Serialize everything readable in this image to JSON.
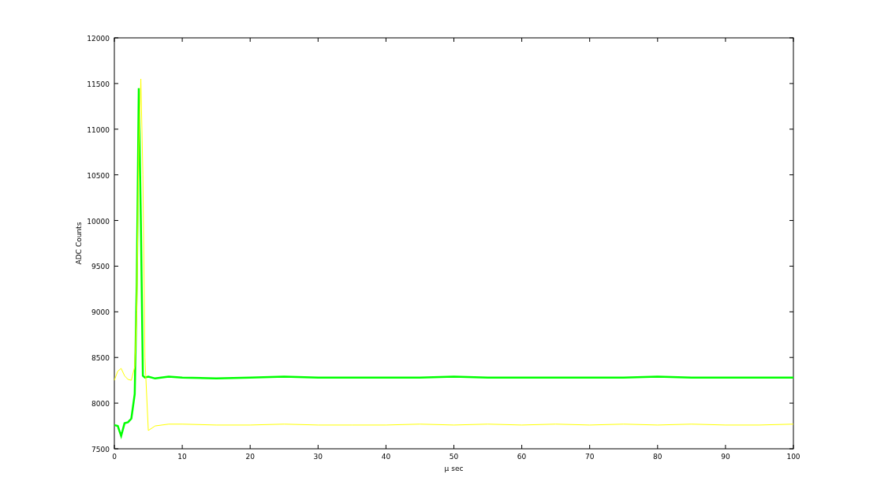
{
  "chart_data": {
    "type": "line",
    "xlabel": "µ sec",
    "ylabel": "ADC Counts",
    "xlim": [
      0,
      100
    ],
    "ylim": [
      7500,
      12000
    ],
    "xticks": [
      0,
      10,
      20,
      30,
      40,
      50,
      60,
      70,
      80,
      90,
      100
    ],
    "yticks": [
      7500,
      8000,
      8500,
      9000,
      9500,
      10000,
      10500,
      11000,
      11500,
      12000
    ],
    "x": [
      0,
      0.5,
      1,
      1.5,
      2,
      2.5,
      3,
      3.3,
      3.6,
      3.9,
      4.2,
      4.5,
      5,
      6,
      8,
      10,
      15,
      20,
      25,
      30,
      35,
      40,
      45,
      50,
      55,
      60,
      65,
      70,
      75,
      80,
      85,
      90,
      95,
      100
    ],
    "series": [
      {
        "color": "#00ff00",
        "values": [
          7760,
          7750,
          7640,
          7780,
          7790,
          7830,
          8100,
          9300,
          11450,
          10000,
          8300,
          8280,
          8290,
          8270,
          8290,
          8280,
          8270,
          8280,
          8290,
          8280,
          8280,
          8280,
          8280,
          8290,
          8280,
          8280,
          8280,
          8280,
          8280,
          8290,
          8280,
          8280,
          8280,
          8280
        ]
      },
      {
        "color": "#ffff00",
        "values": [
          8250,
          8350,
          8380,
          8300,
          8260,
          8250,
          8400,
          9000,
          10800,
          11550,
          10500,
          8500,
          7700,
          7750,
          7770,
          7770,
          7760,
          7760,
          7770,
          7760,
          7760,
          7760,
          7770,
          7760,
          7770,
          7760,
          7770,
          7760,
          7770,
          7760,
          7770,
          7760,
          7760,
          7770
        ]
      }
    ]
  }
}
